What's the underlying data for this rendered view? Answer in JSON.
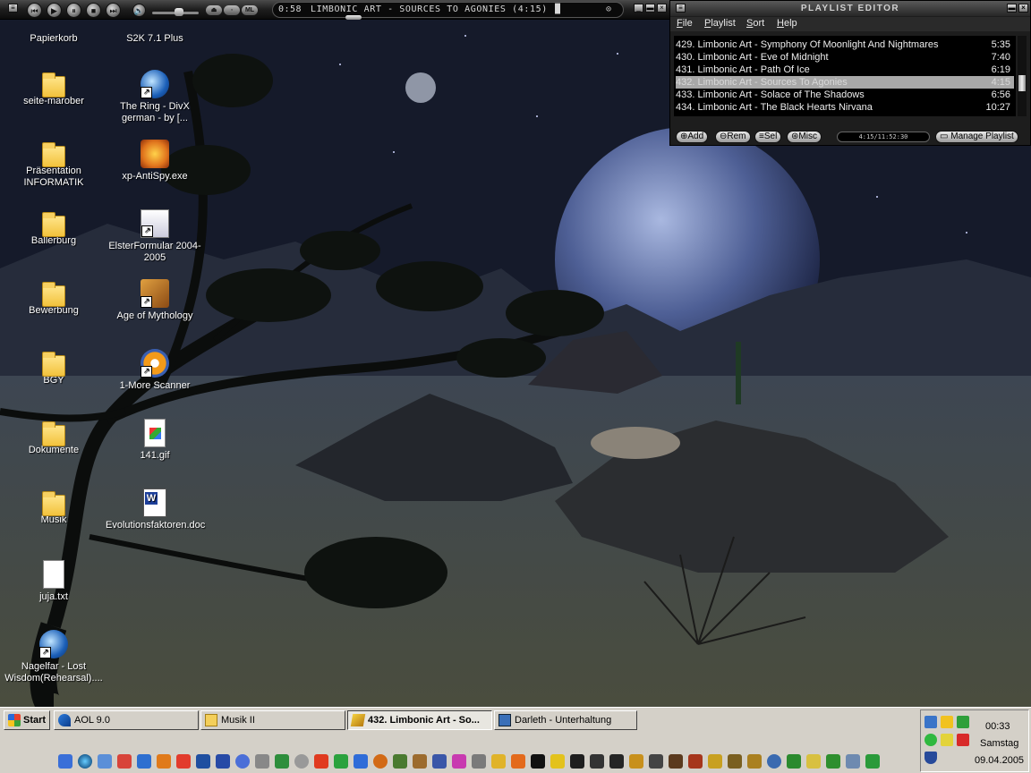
{
  "winamp": {
    "time": "0:58",
    "title": "LIMBONIC ART - SOURCES TO AGONIES (4:15)",
    "controls": [
      "previous",
      "play",
      "pause",
      "stop",
      "next"
    ],
    "buttons": {
      "ml": "ML"
    }
  },
  "playlist_editor": {
    "title": "PLAYLIST EDITOR",
    "menus": [
      "File",
      "Playlist",
      "Sort",
      "Help"
    ],
    "tracks": [
      {
        "label": "429. Limbonic Art - Symphony Of Moonlight And Nightmares",
        "length": "5:35",
        "selected": false
      },
      {
        "label": "430. Limbonic Art - Eve of Midnight",
        "length": "7:40",
        "selected": false
      },
      {
        "label": "431. Limbonic Art - Path Of Ice",
        "length": "6:19",
        "selected": false
      },
      {
        "label": "432. Limbonic Art - Sources To Agonies",
        "length": "4:15",
        "selected": true
      },
      {
        "label": "433. Limbonic Art - Solace of The Shadows",
        "length": "6:56",
        "selected": false
      },
      {
        "label": "434. Limbonic Art - The Black Hearts Nirvana",
        "length": "10:27",
        "selected": false
      }
    ],
    "buttons": {
      "add": "Add",
      "rem": "Rem",
      "sel": "Sel",
      "misc": "Misc",
      "manage": "Manage Playlist"
    },
    "timer": "4:15/11:52:30"
  },
  "desktop_icons": [
    {
      "label": "Papierkorb",
      "icon": "recycle-bin-icon"
    },
    {
      "label": "S2K 7.1 Plus",
      "icon": "s2k-icon"
    },
    {
      "label": "seite-marober",
      "icon": "folder-icon"
    },
    {
      "label": "The Ring - DivX german - by [...",
      "icon": "media-player-icon"
    },
    {
      "label": "Präsentation INFORMATIK",
      "icon": "folder-icon"
    },
    {
      "label": "xp-AntiSpy.exe",
      "icon": "antispy-icon"
    },
    {
      "label": "Ballerburg",
      "icon": "folder-icon"
    },
    {
      "label": "ElsterFormular 2004-2005",
      "icon": "elster-icon"
    },
    {
      "label": "Bewerbung",
      "icon": "folder-icon"
    },
    {
      "label": "Age of Mythology",
      "icon": "age-of-mythology-icon"
    },
    {
      "label": "BGY",
      "icon": "folder-icon"
    },
    {
      "label": "1-More Scanner",
      "icon": "scanner-icon"
    },
    {
      "label": "Dokumente",
      "icon": "folder-icon"
    },
    {
      "label": "141.gif",
      "icon": "gif-file-icon"
    },
    {
      "label": "Musik",
      "icon": "music-folder-icon"
    },
    {
      "label": "Evolutionsfaktoren.doc",
      "icon": "word-document-icon"
    },
    {
      "label": "juja.txt",
      "icon": "text-file-icon"
    },
    {
      "label": "Nagelfar - Lost Wisdom(Rehearsal)....",
      "icon": "media-player-icon"
    }
  ],
  "taskbar": {
    "start": "Start",
    "buttons": [
      {
        "label": "AOL 9.0",
        "active": false
      },
      {
        "label": "Musik II",
        "active": false
      },
      {
        "label": "432. Limbonic Art - So...",
        "active": true
      },
      {
        "label": "Darleth - Unterhaltung",
        "active": false
      }
    ]
  },
  "tray": {
    "time": "00:33",
    "day": "Samstag",
    "date": "09.04.2005"
  },
  "colors": {
    "taskbar": "#d4d0c8",
    "winamp_bg": "#1e1e1e",
    "playlist_selected": "#a8a8a8",
    "sky": "#1b2235"
  }
}
